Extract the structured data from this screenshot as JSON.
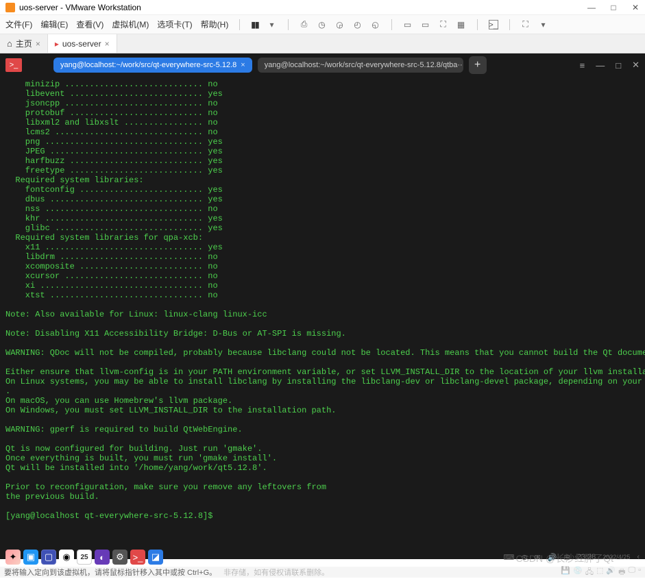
{
  "titlebar": {
    "text": "uos-server - VMware Workstation"
  },
  "menu": {
    "file": "文件(F)",
    "edit": "编辑(E)",
    "view": "查看(V)",
    "vm": "虚拟机(M)",
    "tabs": "选项卡(T)",
    "help": "帮助(H)"
  },
  "apptabs": {
    "home": "主页",
    "active": "uos-server"
  },
  "terminal": {
    "tab_active": "yang@localhost:~/work/src/qt-everywhere-src-5.12.8",
    "tab_inactive": "yang@localhost:~/work/src/qt-everywhere-src-5.12.8/qtba···",
    "lines": [
      "    minizip ............................ no",
      "    libevent ........................... yes",
      "    jsoncpp ............................ no",
      "    protobuf ........................... no",
      "    libxml2 and libxslt ................ no",
      "    lcms2 .............................. no",
      "    png ................................ yes",
      "    JPEG ............................... yes",
      "    harfbuzz ........................... yes",
      "    freetype ........................... yes",
      "  Required system libraries:",
      "    fontconfig ......................... yes",
      "    dbus ............................... yes",
      "    nss ................................ no",
      "    khr ................................ yes",
      "    glibc .............................. yes",
      "  Required system libraries for qpa-xcb:",
      "    x11 ................................ yes",
      "    libdrm ............................. no",
      "    xcomposite ......................... no",
      "    xcursor ............................ no",
      "    xi ................................. no",
      "    xtst ............................... no",
      "",
      "Note: Also available for Linux: linux-clang linux-icc",
      "",
      "Note: Disabling X11 Accessibility Bridge: D-Bus or AT-SPI is missing.",
      "",
      "WARNING: QDoc will not be compiled, probably because libclang could not be located. This means that you cannot build the Qt documentation.",
      "",
      "Either ensure that llvm-config is in your PATH environment variable, or set LLVM_INSTALL_DIR to the location of your llvm installation.",
      "On Linux systems, you may be able to install libclang by installing the libclang-dev or libclang-devel package, depending on your distribution",
      ".",
      "On macOS, you can use Homebrew's llvm package.",
      "On Windows, you must set LLVM_INSTALL_DIR to the installation path.",
      "",
      "WARNING: gperf is required to build QtWebEngine.",
      "",
      "Qt is now configured for building. Just run 'gmake'.",
      "Once everything is built, you must run 'gmake install'.",
      "Qt will be installed into '/home/yang/work/qt5.12.8'.",
      "",
      "Prior to reconfiguration, make sure you remove any leftovers from",
      "the previous build.",
      "",
      "[yang@localhost qt-everywhere-src-5.12.8]$"
    ]
  },
  "taskbar": {
    "cal_day": "25",
    "time": "23:28",
    "date": "2022/4/25"
  },
  "watermark": "CSDN @长沙红胖子Qt",
  "statusbar": {
    "text1": "要将输入定向到该虚拟机，请将鼠标指针移入其中或按 Ctrl+G。",
    "text2": "非存储，如有侵权请联系删除。"
  }
}
